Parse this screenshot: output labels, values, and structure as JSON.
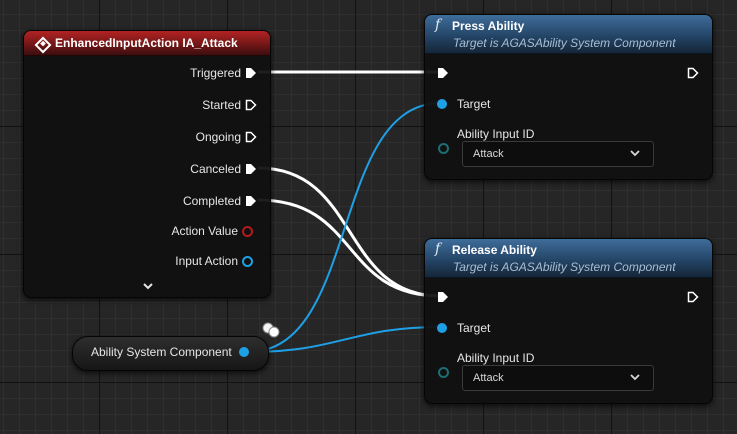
{
  "event_node": {
    "title": "EnhancedInputAction IA_Attack",
    "pins": {
      "triggered": "Triggered",
      "started": "Started",
      "ongoing": "Ongoing",
      "canceled": "Canceled",
      "completed": "Completed",
      "action_value": "Action Value",
      "input_action": "Input Action"
    }
  },
  "press_node": {
    "glyph": "f",
    "title": "Press Ability",
    "subtitle": "Target is AGASAbility System Component",
    "target_label": "Target",
    "input_id_label": "Ability Input ID",
    "input_id_value": "Attack"
  },
  "release_node": {
    "glyph": "f",
    "title": "Release Ability",
    "subtitle": "Target is AGASAbility System Component",
    "target_label": "Target",
    "input_id_label": "Ability Input ID",
    "input_id_value": "Attack"
  },
  "variable_node": {
    "label": "Ability System Component"
  },
  "colors": {
    "event_header": "#8b1d1d",
    "function_header": "#2c5278",
    "object_pin": "#1fa0e6",
    "exec_wire": "#ffffff"
  }
}
